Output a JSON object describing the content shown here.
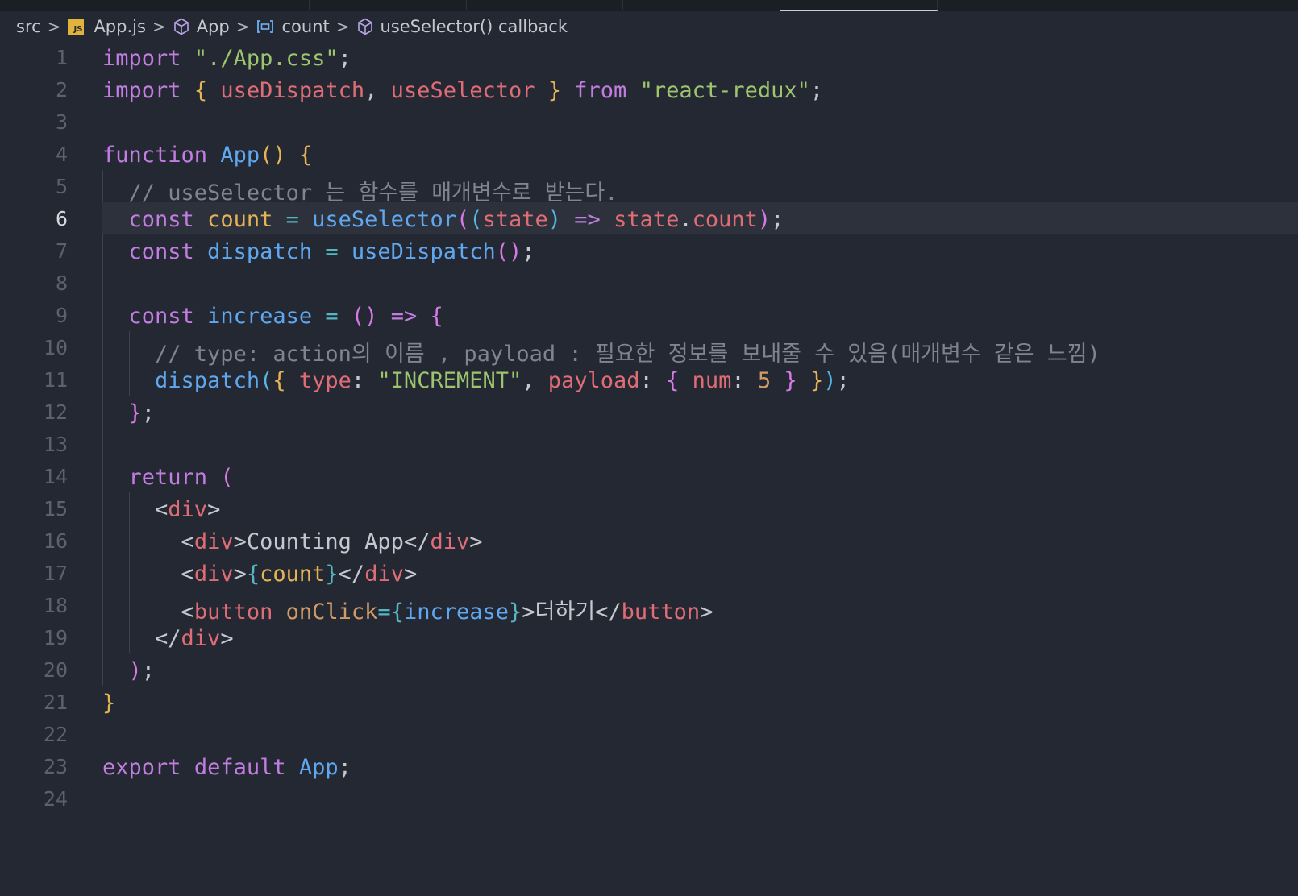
{
  "breadcrumb": {
    "items": [
      {
        "label": "src",
        "icon": "none"
      },
      {
        "label": "App.js",
        "icon": "js-file-icon",
        "icon_text": "JS"
      },
      {
        "label": "App",
        "icon": "cube-icon"
      },
      {
        "label": "count",
        "icon": "variable-icon"
      },
      {
        "label": "useSelector() callback",
        "icon": "cube-icon"
      }
    ],
    "separator": ">"
  },
  "editor": {
    "current_line": 6,
    "lines": [
      {
        "n": "1",
        "tokens": [
          [
            "k",
            "import"
          ],
          [
            "w",
            " "
          ],
          [
            "s",
            "\"./App.css\""
          ],
          [
            "w",
            ";"
          ]
        ]
      },
      {
        "n": "2",
        "tokens": [
          [
            "k",
            "import"
          ],
          [
            "w",
            " "
          ],
          [
            "b1",
            "{"
          ],
          [
            "w",
            " "
          ],
          [
            "p",
            "useDispatch"
          ],
          [
            "w",
            ", "
          ],
          [
            "p",
            "useSelector"
          ],
          [
            "w",
            " "
          ],
          [
            "b1",
            "}"
          ],
          [
            "w",
            " "
          ],
          [
            "k",
            "from"
          ],
          [
            "w",
            " "
          ],
          [
            "s",
            "\"react-redux\""
          ],
          [
            "w",
            ";"
          ]
        ]
      },
      {
        "n": "3",
        "tokens": []
      },
      {
        "n": "4",
        "tokens": [
          [
            "k",
            "function"
          ],
          [
            "w",
            " "
          ],
          [
            "f",
            "App"
          ],
          [
            "b1",
            "()"
          ],
          [
            "w",
            " "
          ],
          [
            "b1",
            "{"
          ]
        ]
      },
      {
        "n": "5",
        "tokens": [
          [
            "w",
            "  "
          ],
          [
            "c",
            "// useSelector 는 함수를 매개변수로 받는다."
          ]
        ]
      },
      {
        "n": "6",
        "tokens": [
          [
            "w",
            "  "
          ],
          [
            "k",
            "const"
          ],
          [
            "w",
            " "
          ],
          [
            "v",
            "count"
          ],
          [
            "w",
            " "
          ],
          [
            "o",
            "="
          ],
          [
            "w",
            " "
          ],
          [
            "f",
            "useSelector"
          ],
          [
            "b2",
            "("
          ],
          [
            "b3",
            "("
          ],
          [
            "p",
            "state"
          ],
          [
            "b3",
            ")"
          ],
          [
            "w",
            " "
          ],
          [
            "k",
            "=>"
          ],
          [
            "w",
            " "
          ],
          [
            "p",
            "state"
          ],
          [
            "w",
            "."
          ],
          [
            "p",
            "count"
          ],
          [
            "b2",
            ")"
          ],
          [
            "w",
            ";"
          ]
        ]
      },
      {
        "n": "7",
        "tokens": [
          [
            "w",
            "  "
          ],
          [
            "k",
            "const"
          ],
          [
            "w",
            " "
          ],
          [
            "vb",
            "dispatch"
          ],
          [
            "w",
            " "
          ],
          [
            "o",
            "="
          ],
          [
            "w",
            " "
          ],
          [
            "f",
            "useDispatch"
          ],
          [
            "b2",
            "()"
          ],
          [
            "w",
            ";"
          ]
        ]
      },
      {
        "n": "8",
        "tokens": []
      },
      {
        "n": "9",
        "tokens": [
          [
            "w",
            "  "
          ],
          [
            "k",
            "const"
          ],
          [
            "w",
            " "
          ],
          [
            "vb",
            "increase"
          ],
          [
            "w",
            " "
          ],
          [
            "o",
            "="
          ],
          [
            "w",
            " "
          ],
          [
            "b2",
            "()"
          ],
          [
            "w",
            " "
          ],
          [
            "k",
            "=>"
          ],
          [
            "w",
            " "
          ],
          [
            "b2",
            "{"
          ]
        ]
      },
      {
        "n": "10",
        "tokens": [
          [
            "w",
            "    "
          ],
          [
            "c",
            "// type: action의 이름 , payload : 필요한 정보를 보내줄 수 있음(매개변수 같은 느낌)"
          ]
        ]
      },
      {
        "n": "11",
        "tokens": [
          [
            "w",
            "    "
          ],
          [
            "f",
            "dispatch"
          ],
          [
            "b3",
            "("
          ],
          [
            "b1",
            "{"
          ],
          [
            "w",
            " "
          ],
          [
            "p",
            "type"
          ],
          [
            "w",
            ": "
          ],
          [
            "s",
            "\"INCREMENT\""
          ],
          [
            "w",
            ", "
          ],
          [
            "p",
            "payload"
          ],
          [
            "w",
            ": "
          ],
          [
            "b2",
            "{"
          ],
          [
            "w",
            " "
          ],
          [
            "p",
            "num"
          ],
          [
            "w",
            ": "
          ],
          [
            "n",
            "5"
          ],
          [
            "w",
            " "
          ],
          [
            "b2",
            "}"
          ],
          [
            "w",
            " "
          ],
          [
            "b1",
            "}"
          ],
          [
            "b3",
            ")"
          ],
          [
            "w",
            ";"
          ]
        ]
      },
      {
        "n": "12",
        "tokens": [
          [
            "w",
            "  "
          ],
          [
            "b2",
            "}"
          ],
          [
            "w",
            ";"
          ]
        ]
      },
      {
        "n": "13",
        "tokens": []
      },
      {
        "n": "14",
        "tokens": [
          [
            "w",
            "  "
          ],
          [
            "k",
            "return"
          ],
          [
            "w",
            " "
          ],
          [
            "b2",
            "("
          ]
        ]
      },
      {
        "n": "15",
        "tokens": [
          [
            "w",
            "    "
          ],
          [
            "w",
            "<"
          ],
          [
            "t",
            "div"
          ],
          [
            "w",
            ">"
          ]
        ]
      },
      {
        "n": "16",
        "tokens": [
          [
            "w",
            "      "
          ],
          [
            "w",
            "<"
          ],
          [
            "t",
            "div"
          ],
          [
            "w",
            ">"
          ],
          [
            "w",
            "Counting App"
          ],
          [
            "w",
            "</"
          ],
          [
            "t",
            "div"
          ],
          [
            "w",
            ">"
          ]
        ]
      },
      {
        "n": "17",
        "tokens": [
          [
            "w",
            "      "
          ],
          [
            "w",
            "<"
          ],
          [
            "t",
            "div"
          ],
          [
            "w",
            ">"
          ],
          [
            "o",
            "{"
          ],
          [
            "v",
            "count"
          ],
          [
            "o",
            "}"
          ],
          [
            "w",
            "</"
          ],
          [
            "t",
            "div"
          ],
          [
            "w",
            ">"
          ]
        ]
      },
      {
        "n": "18",
        "tokens": [
          [
            "w",
            "      "
          ],
          [
            "w",
            "<"
          ],
          [
            "t",
            "button"
          ],
          [
            "w",
            " "
          ],
          [
            "a",
            "onClick"
          ],
          [
            "o",
            "="
          ],
          [
            "o",
            "{"
          ],
          [
            "vb",
            "increase"
          ],
          [
            "o",
            "}"
          ],
          [
            "w",
            ">"
          ],
          [
            "w",
            "더하기"
          ],
          [
            "w",
            "</"
          ],
          [
            "t",
            "button"
          ],
          [
            "w",
            ">"
          ]
        ]
      },
      {
        "n": "19",
        "tokens": [
          [
            "w",
            "    "
          ],
          [
            "w",
            "</"
          ],
          [
            "t",
            "div"
          ],
          [
            "w",
            ">"
          ]
        ]
      },
      {
        "n": "20",
        "tokens": [
          [
            "w",
            "  "
          ],
          [
            "b2",
            ")"
          ],
          [
            "w",
            ";"
          ]
        ]
      },
      {
        "n": "21",
        "tokens": [
          [
            "b1",
            "}"
          ]
        ]
      },
      {
        "n": "22",
        "tokens": []
      },
      {
        "n": "23",
        "tokens": [
          [
            "k",
            "export"
          ],
          [
            "w",
            " "
          ],
          [
            "k",
            "default"
          ],
          [
            "w",
            " "
          ],
          [
            "f",
            "App"
          ],
          [
            "w",
            ";"
          ]
        ]
      },
      {
        "n": "24",
        "tokens": []
      }
    ]
  }
}
